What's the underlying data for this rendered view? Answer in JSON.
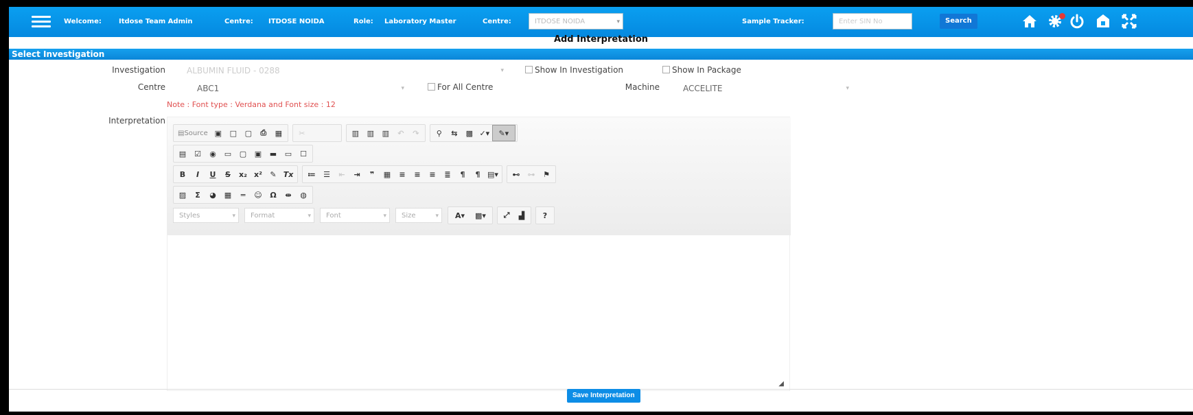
{
  "topbar": {
    "welcome_label": "Welcome:",
    "user_name": "Itdose Team Admin",
    "centre_label": "Centre:",
    "centre_name": "ITDOSE NOIDA",
    "role_label": "Role:",
    "role_name": "Laboratory Master",
    "centre_select_label": "Centre:",
    "centre_select_value": "ITDOSE NOIDA",
    "sample_tracker_label": "Sample Tracker:",
    "sample_tracker_placeholder": "Enter SIN No",
    "search_label": "Search",
    "icons": [
      "home-icon",
      "gear-icon",
      "power-icon",
      "lock-icon",
      "fullscreen-icon"
    ],
    "notification_color": "#e53935"
  },
  "page": {
    "title": "Add Interpretation",
    "section_header": "Select Investigation"
  },
  "form": {
    "investigation_label": "Investigation",
    "investigation_value": "ALBUMIN FLUID - 0288",
    "show_in_investigation": "Show In Investigation",
    "show_in_package": "Show In Package",
    "centre_label": "Centre",
    "centre_value": "ABC1",
    "for_all_centre": "For All Centre",
    "machine_label": "Machine",
    "machine_value": "ACCELITE",
    "note": "Note : Font type : Verdana and Font size : 12",
    "interpretation_label": "Interpretation"
  },
  "editor": {
    "source_label": "Source",
    "styles_label": "Styles",
    "format_label": "Format",
    "font_label": "Font",
    "size_label": "Size",
    "font_color_label": "A",
    "help_label": "?"
  },
  "actions": {
    "save_label": "Save Interpretation"
  },
  "colors": {
    "topbar": "#0a9ff0",
    "section_header": "#16a0ee",
    "note": "#e05050",
    "button": "#0d8de6"
  }
}
